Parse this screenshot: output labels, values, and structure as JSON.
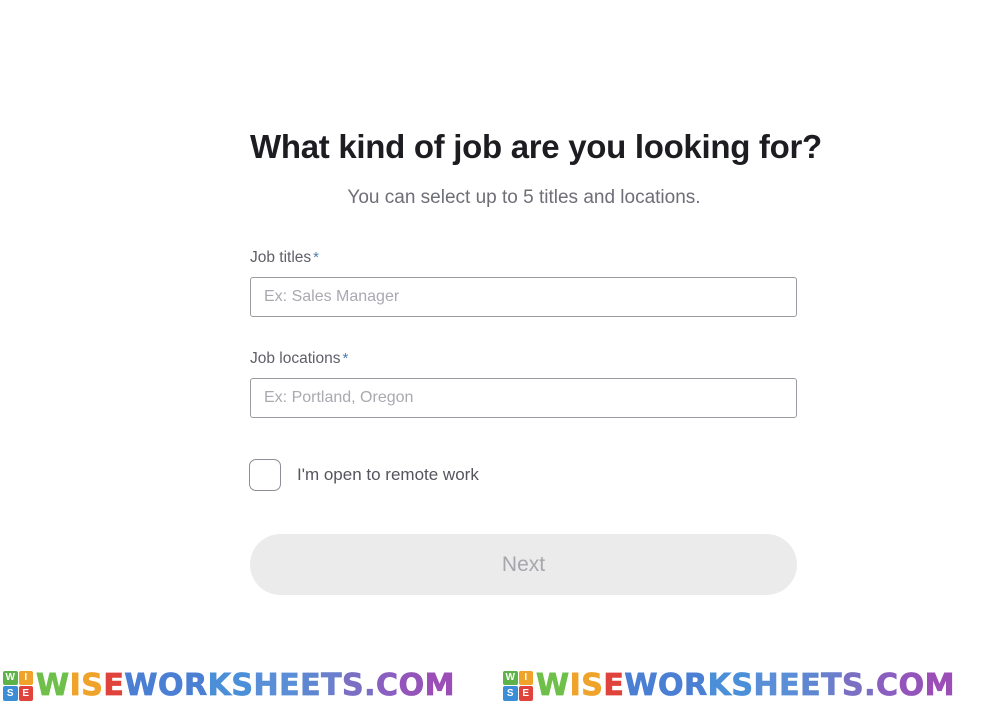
{
  "header": {
    "title": "What kind of job are you looking for?",
    "subtitle": "You can select up to 5 titles and locations."
  },
  "form": {
    "fields": [
      {
        "label": "Job titles",
        "required_marker": "*",
        "placeholder": "Ex: Sales Manager",
        "value": ""
      },
      {
        "label": "Job locations",
        "required_marker": "*",
        "placeholder": "Ex: Portland, Oregon",
        "value": ""
      }
    ],
    "remote_checkbox": {
      "label": "I'm open to remote work",
      "checked": false,
      "icon": "checkbox-unchecked-icon"
    },
    "submit": {
      "label": "Next",
      "state": "disabled"
    }
  },
  "watermark": {
    "logo_letters": [
      "W",
      "I",
      "S",
      "E"
    ],
    "logo_colors": [
      "#5eb24a",
      "#f0a32a",
      "#3b8ed6",
      "#e0423c"
    ],
    "text_segments": [
      {
        "text": "W",
        "color": "#6fc04a"
      },
      {
        "text": "I",
        "color": "#f0a32a"
      },
      {
        "text": "S",
        "color": "#f0a32a"
      },
      {
        "text": "E",
        "color": "#e0423c"
      },
      {
        "text": "W",
        "color": "#4b7fd4"
      },
      {
        "text": "O",
        "color": "#4b7fd4"
      },
      {
        "text": "R",
        "color": "#4b7fd4"
      },
      {
        "text": "K",
        "color": "#4b8fd8"
      },
      {
        "text": "S",
        "color": "#4b8fd8"
      },
      {
        "text": "H",
        "color": "#5a8fd8"
      },
      {
        "text": "E",
        "color": "#5a8fd8"
      },
      {
        "text": "E",
        "color": "#5f86d0"
      },
      {
        "text": "T",
        "color": "#6b7fcc"
      },
      {
        "text": "S",
        "color": "#7b6fc4"
      },
      {
        "text": ".",
        "color": "#7b6fc4"
      },
      {
        "text": "C",
        "color": "#8a5fc0"
      },
      {
        "text": "O",
        "color": "#9455bb"
      },
      {
        "text": "M",
        "color": "#9b4fb6"
      }
    ],
    "full_text": "WISEWORKSHEETS.COM",
    "repeat_count": 2
  },
  "colors": {
    "page_background": "#ffffff",
    "title_text": "#1c1c21",
    "subtitle_text": "#6e6e76",
    "label_text": "#5f5f68",
    "required_star": "#4d7db5",
    "input_border": "#9b9ba2",
    "placeholder_text": "#a9a9b0",
    "checkbox_border": "#8e8e97",
    "button_background": "#ebebeb",
    "button_text": "#a6a6ad"
  }
}
